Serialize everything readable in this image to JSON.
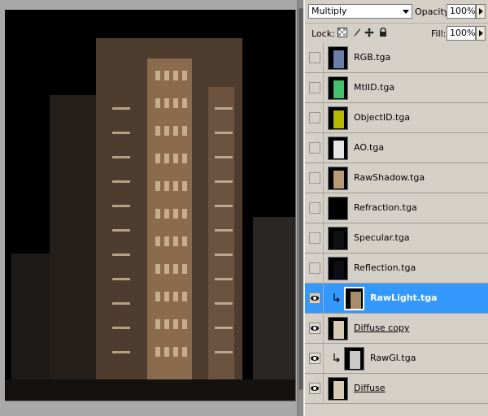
{
  "blend_mode": "Multiply",
  "opacity": {
    "label": "Opacity:",
    "value": "100%"
  },
  "lock": {
    "label": "Lock:"
  },
  "fill": {
    "label": "Fill:",
    "value": "100%"
  },
  "layers": [
    {
      "name": "RGB.tga",
      "visible": false,
      "selected": false,
      "clipped": false,
      "underline": false,
      "thumb_color": "#6a7fa8"
    },
    {
      "name": "MtlID.tga",
      "visible": false,
      "selected": false,
      "clipped": false,
      "underline": false,
      "thumb_color": "#43c06b"
    },
    {
      "name": "ObjectID.tga",
      "visible": false,
      "selected": false,
      "clipped": false,
      "underline": false,
      "thumb_color": "#b8b800"
    },
    {
      "name": "AO.tga",
      "visible": false,
      "selected": false,
      "clipped": false,
      "underline": false,
      "thumb_color": "#e6e6e6"
    },
    {
      "name": "RawShadow.tga",
      "visible": false,
      "selected": false,
      "clipped": false,
      "underline": false,
      "thumb_color": "#b89a77"
    },
    {
      "name": "Refraction.tga",
      "visible": false,
      "selected": false,
      "clipped": false,
      "underline": false,
      "thumb_color": "#000000"
    },
    {
      "name": "Specular.tga",
      "visible": false,
      "selected": false,
      "clipped": false,
      "underline": false,
      "thumb_color": "#111111"
    },
    {
      "name": "Reflection.tga",
      "visible": false,
      "selected": false,
      "clipped": false,
      "underline": false,
      "thumb_color": "#0d0d14"
    },
    {
      "name": "RawLight.tga",
      "visible": true,
      "selected": true,
      "clipped": true,
      "underline": false,
      "thumb_color": "#a88d6c"
    },
    {
      "name": "Diffuse copy",
      "visible": true,
      "selected": false,
      "clipped": false,
      "underline": true,
      "thumb_color": "#d9cab3"
    },
    {
      "name": "RawGI.tga",
      "visible": true,
      "selected": false,
      "clipped": true,
      "underline": false,
      "thumb_color": "#c9c9c9"
    },
    {
      "name": "Diffuse",
      "visible": true,
      "selected": false,
      "clipped": false,
      "underline": true,
      "thumb_color": "#d9cab3"
    }
  ]
}
